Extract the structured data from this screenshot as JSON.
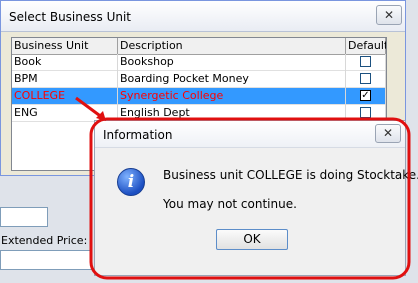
{
  "background": {
    "extended_price_label": "Extended Price:"
  },
  "select_window": {
    "title": "Select Business Unit",
    "close_symbol": "✕",
    "columns": [
      "Business Unit",
      "Description",
      "Default"
    ],
    "rows": [
      {
        "unit": "Book",
        "description": "Bookshop",
        "default": false,
        "selected": false
      },
      {
        "unit": "BPM",
        "description": "Boarding Pocket Money",
        "default": false,
        "selected": false
      },
      {
        "unit": "COLLEGE",
        "description": "Synergetic College",
        "default": true,
        "selected": true
      },
      {
        "unit": "ENG",
        "description": "English Dept",
        "default": false,
        "selected": false
      }
    ]
  },
  "info_dialog": {
    "title": "Information",
    "close_symbol": "✕",
    "icon": "information-icon",
    "message_line1": "Business unit COLLEGE is doing Stocktake.",
    "message_line2": "You may not continue.",
    "ok_label": "OK"
  },
  "colors": {
    "selection": "#3399ff",
    "selected_text": "#ff0000",
    "annotation": "#e01010"
  }
}
